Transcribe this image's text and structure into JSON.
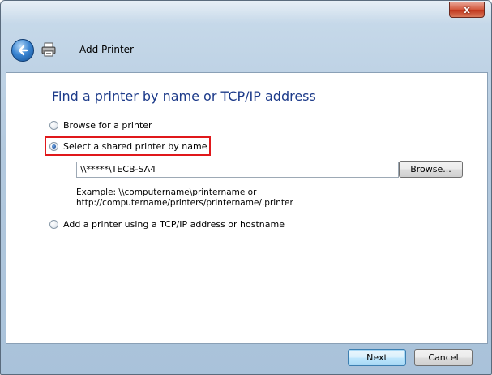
{
  "window": {
    "close_label": "x",
    "title": "Add Printer"
  },
  "icons": {
    "back": "back-arrow-icon",
    "printer": "printer-icon",
    "close": "close-icon"
  },
  "main": {
    "heading": "Find a printer by name or TCP/IP address",
    "options": [
      {
        "label": "Browse for a printer",
        "selected": false
      },
      {
        "label": "Select a shared printer by name",
        "selected": true
      },
      {
        "label": "Add a printer using a TCP/IP address or hostname",
        "selected": false
      }
    ],
    "printer_name_value": "\\\\*****\\TECB-SA4",
    "browse_label": "Browse...",
    "example_line1": "Example: \\\\computername\\printername or",
    "example_line2": "http://computername/printers/printername/.printer"
  },
  "footer": {
    "next_label": "Next",
    "cancel_label": "Cancel"
  },
  "colors": {
    "heading": "#1d3b8a",
    "highlight": "#e0181b",
    "close_button": "#c0351c"
  }
}
